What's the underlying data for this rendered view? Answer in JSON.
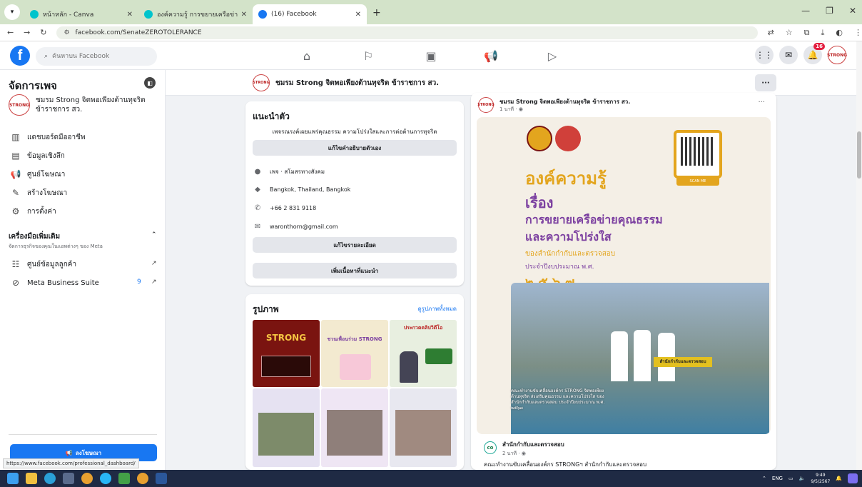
{
  "browser": {
    "tabs": [
      {
        "title": "หน้าหลัก - Canva",
        "color": "#00c4cc"
      },
      {
        "title": "องค์ความรู้ การขยายเครือข่ายคุณธรร",
        "color": "#00c4cc"
      },
      {
        "title": "(16) Facebook",
        "color": "#1877f2"
      }
    ],
    "new_tab": "+",
    "url": "facebook.com/SenateZEROTOLERANCE"
  },
  "topbar": {
    "logo": "f",
    "search_placeholder": "ค้นหาบน Facebook",
    "notif_count": "16"
  },
  "sidebar": {
    "title": "จัดการเพจ",
    "page_name": "ชมรม Strong จิตพอเพียงต้านทุจริต ข้าราชการ สว.",
    "items": [
      {
        "label": "แดชบอร์ดมืออาชีพ",
        "icon": "dashboard-icon"
      },
      {
        "label": "ข้อมูลเชิงลึก",
        "icon": "insights-icon"
      },
      {
        "label": "ศูนย์โฆษณา",
        "icon": "megaphone-icon"
      },
      {
        "label": "สร้างโฆษณา",
        "icon": "pencil-icon"
      },
      {
        "label": "การตั้งค่า",
        "icon": "gear-icon"
      }
    ],
    "tools_title": "เครื่องมือเพิ่มเติม",
    "tools_sub": "จัดการธุรกิจของคุณในแอพต่างๆ ของ Meta",
    "tools": [
      {
        "label": "ศูนย์ข้อมูลลูกค้า",
        "count": ""
      },
      {
        "label": "Meta Business Suite",
        "count": "9"
      }
    ],
    "promote": "ลงโฆษณา"
  },
  "page_header": {
    "name": "ชมรม Strong จิตพอเพียงต้านทุจริต ข้าราชการ สว.",
    "more": "···"
  },
  "intro": {
    "title": "แนะนำตัว",
    "bio": "เพจรณรงค์เผยแพร่คุณธรรม ความโปร่งใสและการต่อต้านการทุจริต",
    "edit_bio": "แก้ไขคำอธิบายตัวเอง",
    "category": "เพจ · สโมสรทางสังคม",
    "category_bold": "เพจ",
    "location": "Bangkok, Thailand, Bangkok",
    "phone": "+66 2 831 9118",
    "email": "waronthorn@gmail.com",
    "edit_details": "แก้ไขรายละเอียด",
    "add_featured": "เพิ่มเนื้อหาที่แนะนำ"
  },
  "photos": {
    "title": "รูปภาพ",
    "see_all": "ดูรูปภาพทั้งหมด",
    "thumbs": [
      {
        "caption": "STRONG",
        "bg": "#7a1410"
      },
      {
        "caption": "ชวนเพื่อนร่วม STRONG",
        "bg": "#f3ead0"
      },
      {
        "caption": "ประกวดคลิปวิดีโอ",
        "bg": "#e8efe0"
      },
      {
        "caption": "",
        "bg": "#e6e2f2"
      },
      {
        "caption": "",
        "bg": "#efe6f4"
      },
      {
        "caption": "",
        "bg": "#e8e8f0"
      }
    ]
  },
  "post": {
    "author": "ชมรม Strong จิตพอเพียงต้านทุจริต ข้าราชการ สว.",
    "time": "1 นาที · ",
    "more": "···",
    "image": {
      "headline1": "องค์ความรู้",
      "headline2": "เรื่อง",
      "headline3": "การขยายเครือข่ายคุณธรรม",
      "headline4": "และความโปร่งใส",
      "sub1": "ของสำนักกำกับและตรวจสอบ",
      "sub2": "ประจำปีงบประมาณ พ.ศ.",
      "year": "๒ ๕ ๖ ๗",
      "scan": "SCAN ME",
      "sign": "สำนักกำกับและตรวจสอบ",
      "caption": "คณะทำงานขับเคลื่อนองค์กร STRONG จิตพอเพียงต้านทุจริต ส่งเสริมคุณธรรม และความโปร่งใส ของสำนักกำกับและตรวจสอบ ประจำปีงบประมาณ พ.ศ. ๒๕๖๗"
    },
    "shared_name": "สำนักกำกับและตรวจสอบ",
    "shared_time": "2 นาที · ",
    "shared_text": "คณะทำงานขับเคลื่อนองค์กร STRONGฯ สำนักกำกับและตรวจสอบ"
  },
  "status_url": "https://www.facebook.com/professional_dashboard/",
  "taskbar": {
    "lang": "ENG",
    "time": "9:49",
    "date": "9/5/2567"
  },
  "colors": {
    "fb_blue": "#1877f2",
    "gold": "#e3a51e",
    "purple": "#7b3fa0"
  }
}
